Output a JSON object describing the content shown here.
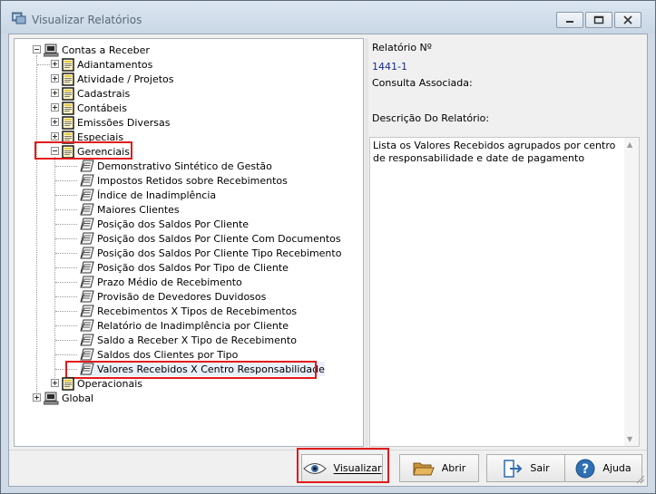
{
  "window": {
    "title": "Visualizar Relatórios",
    "controls": [
      "minimize",
      "maximize",
      "close"
    ]
  },
  "tree": {
    "roots": [
      {
        "label": "Contas a Receber",
        "expanded": true,
        "icon": "computer-icon",
        "children": [
          {
            "label": "Adiantamentos",
            "icon": "folder-icon"
          },
          {
            "label": "Atividade / Projetos",
            "icon": "folder-icon"
          },
          {
            "label": "Cadastrais",
            "icon": "folder-icon"
          },
          {
            "label": "Contábeis",
            "icon": "folder-icon"
          },
          {
            "label": "Emissões Diversas",
            "icon": "folder-icon"
          },
          {
            "label": "Especiais",
            "icon": "folder-icon"
          },
          {
            "label": "Gerenciais",
            "icon": "folder-icon",
            "expanded": true,
            "highlighted": true,
            "children": [
              "Demonstrativo Sintético de Gestão",
              "Impostos Retidos sobre Recebimentos",
              "Índice de Inadimplência",
              "Maiores Clientes",
              "Posição dos Saldos Por Cliente",
              "Posição dos Saldos Por Cliente Com Documentos",
              "Posição dos Saldos Por Cliente Tipo Recebimento",
              "Posição dos Saldos Por Tipo de Cliente",
              "Prazo Médio de Recebimento",
              "Provisão de Devedores Duvidosos",
              "Recebimentos X Tipos de Recebimentos",
              "Relatório de Inadimplência por Cliente",
              "Saldo a Receber X Tipo de Recebimento",
              "Saldos dos Clientes por Tipo",
              "Valores Recebidos X Centro Responsabilidade"
            ],
            "selected_child": "Valores Recebidos X Centro Responsabilidade"
          },
          {
            "label": "Operacionais",
            "icon": "folder-icon"
          }
        ]
      },
      {
        "label": "Global",
        "icon": "computer-icon",
        "expanded": false
      }
    ]
  },
  "details": {
    "report_no_label": "Relatório Nº",
    "report_no_value": "1441-1",
    "query_label": "Consulta Associada:",
    "query_value": "",
    "description_label": "Descrição Do Relatório:",
    "description_text": "Lista os Valores Recebidos agrupados por centro de responsabilidade e date de pagamento"
  },
  "buttons": {
    "visualizar": "Visualizar",
    "abrir": "Abrir",
    "sair": "Sair",
    "ajuda": "Ajuda"
  },
  "colors": {
    "highlight": "#e21b1b",
    "titlebar": "#cfdae6",
    "folder": "#e8c84a"
  }
}
